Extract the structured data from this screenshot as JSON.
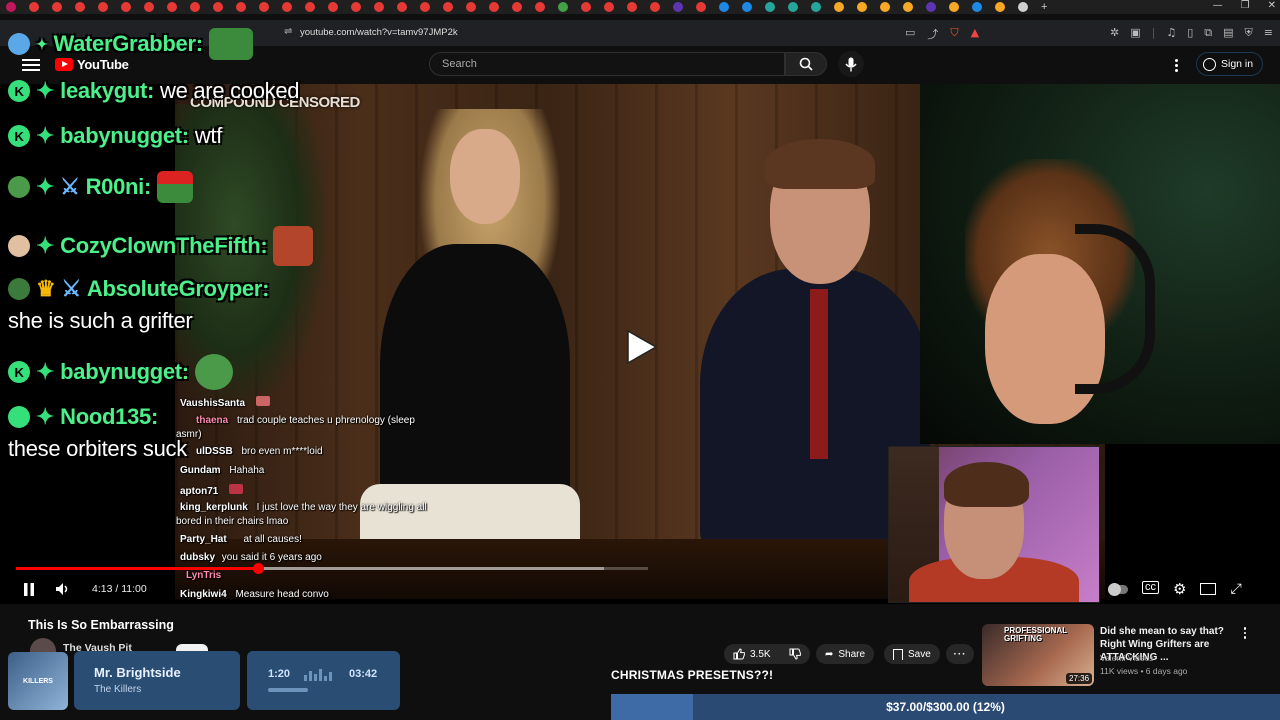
{
  "browser": {
    "url": "youtube.com/watch?v=tamv97JMP2k",
    "tab_colors": [
      "#c2185b",
      "#e53935",
      "#e53935",
      "#e53935",
      "#e53935",
      "#e53935",
      "#e53935",
      "#e53935",
      "#e53935",
      "#e53935",
      "#e53935",
      "#e53935",
      "#e53935",
      "#e53935",
      "#e53935",
      "#e53935",
      "#e53935",
      "#e53935",
      "#e53935",
      "#e53935",
      "#e53935",
      "#e53935",
      "#e53935",
      "#e53935",
      "#43a047",
      "#e53935",
      "#e53935",
      "#e53935",
      "#e53935",
      "#5e35b1",
      "#e53935",
      "#1e88e5",
      "#1e88e5",
      "#26a69a",
      "#26a69a",
      "#26a69a",
      "#f9a825",
      "#f9a825",
      "#f9a825",
      "#f9a825",
      "#5e35b1",
      "#f9a825",
      "#1e88e5",
      "#f9a825",
      "#cfcfcf"
    ],
    "new_tab_label": "+",
    "window_controls": [
      "—",
      "❐",
      "✕"
    ]
  },
  "youtube": {
    "logo_text": "YouTube",
    "search_placeholder": "Search",
    "sign_in_label": "Sign in"
  },
  "video": {
    "overlay_title": "COMPOUND CENSORED",
    "time_display": "4:13 / 11:00",
    "progress_fraction": 0.383,
    "buffered_fraction": 0.93
  },
  "chat_big": [
    {
      "user": "WaterGrabber:",
      "msg": "",
      "badges": [
        "moon"
      ],
      "emote": "pepe"
    },
    {
      "user": "leakygut:",
      "msg": "we are cooked",
      "badges": [
        "K",
        "diamond"
      ]
    },
    {
      "user": "babynugget:",
      "msg": "wtf",
      "badges": [
        "K",
        "diamond"
      ]
    },
    {
      "user": "R00ni:",
      "msg": "",
      "badges": [
        "pepe",
        "diamond",
        "sword"
      ],
      "emote": "santa-pepe"
    },
    {
      "user": "CozyClownTheFifth:",
      "msg": "",
      "badges": [
        "clown",
        "diamond"
      ],
      "emote": "face"
    },
    {
      "user": "AbsoluteGroyper:",
      "msg": "",
      "badges": [
        "pepe",
        "crown",
        "sword"
      ]
    },
    {
      "user": "babynugget:",
      "msg": "",
      "badges": [
        "K",
        "diamond"
      ],
      "emote": "pepe-shout"
    },
    {
      "user": "Nood135:",
      "msg": "",
      "badges": [
        "heart",
        "diamond"
      ]
    }
  ],
  "chat_big_lines": {
    "groyper_msg": "she is such a grifter",
    "nood_msg": "these orbiters suck"
  },
  "chat_small": [
    {
      "user": "VaushisSanta",
      "msg": ""
    },
    {
      "user": "thaena",
      "msg": "trad couple teaches u phrenology (sleep"
    },
    {
      "user": "",
      "msg": "asmr)"
    },
    {
      "user": "ulDSSB",
      "msg": "bro even m****loid"
    },
    {
      "user": "Gundam",
      "msg": "Hahaha"
    },
    {
      "user": "apton71",
      "msg": ""
    },
    {
      "user": "king_kerplunk",
      "msg": "I just love the way they are wiggling all"
    },
    {
      "user": "",
      "msg": "bored in their chairs lmao"
    },
    {
      "user": "Party_Hat",
      "msg": "at all causes!"
    },
    {
      "user": "dubsky",
      "msg": "you said it 6 years ago"
    },
    {
      "user": "LynTris",
      "msg": ""
    },
    {
      "user": "Kingkiwi4",
      "msg": "Measure head convo"
    }
  ],
  "under": {
    "title": "This Is So Embarrassing",
    "channel": "The Vaush Pit",
    "likes": "3.5K",
    "share_label": "Share",
    "save_label": "Save"
  },
  "music": {
    "song": "Mr. Brightside",
    "artist": "The Killers",
    "elapsed": "1:20",
    "duration": "03:42",
    "art_label": "KILLERS"
  },
  "goal": {
    "title": "CHRISTMAS PRESETNS??!",
    "progress_text": "$37.00/$300.00 (12%)",
    "fraction": 0.123
  },
  "recommendation": {
    "thumb_text": "PROFESSIONAL GRIFTING",
    "duration": "27:36",
    "title": "Did she mean to say that? Right Wing Grifters are ATTACKING ...",
    "channel": "Valenti Videos",
    "meta": "11K views • 6 days ago"
  }
}
